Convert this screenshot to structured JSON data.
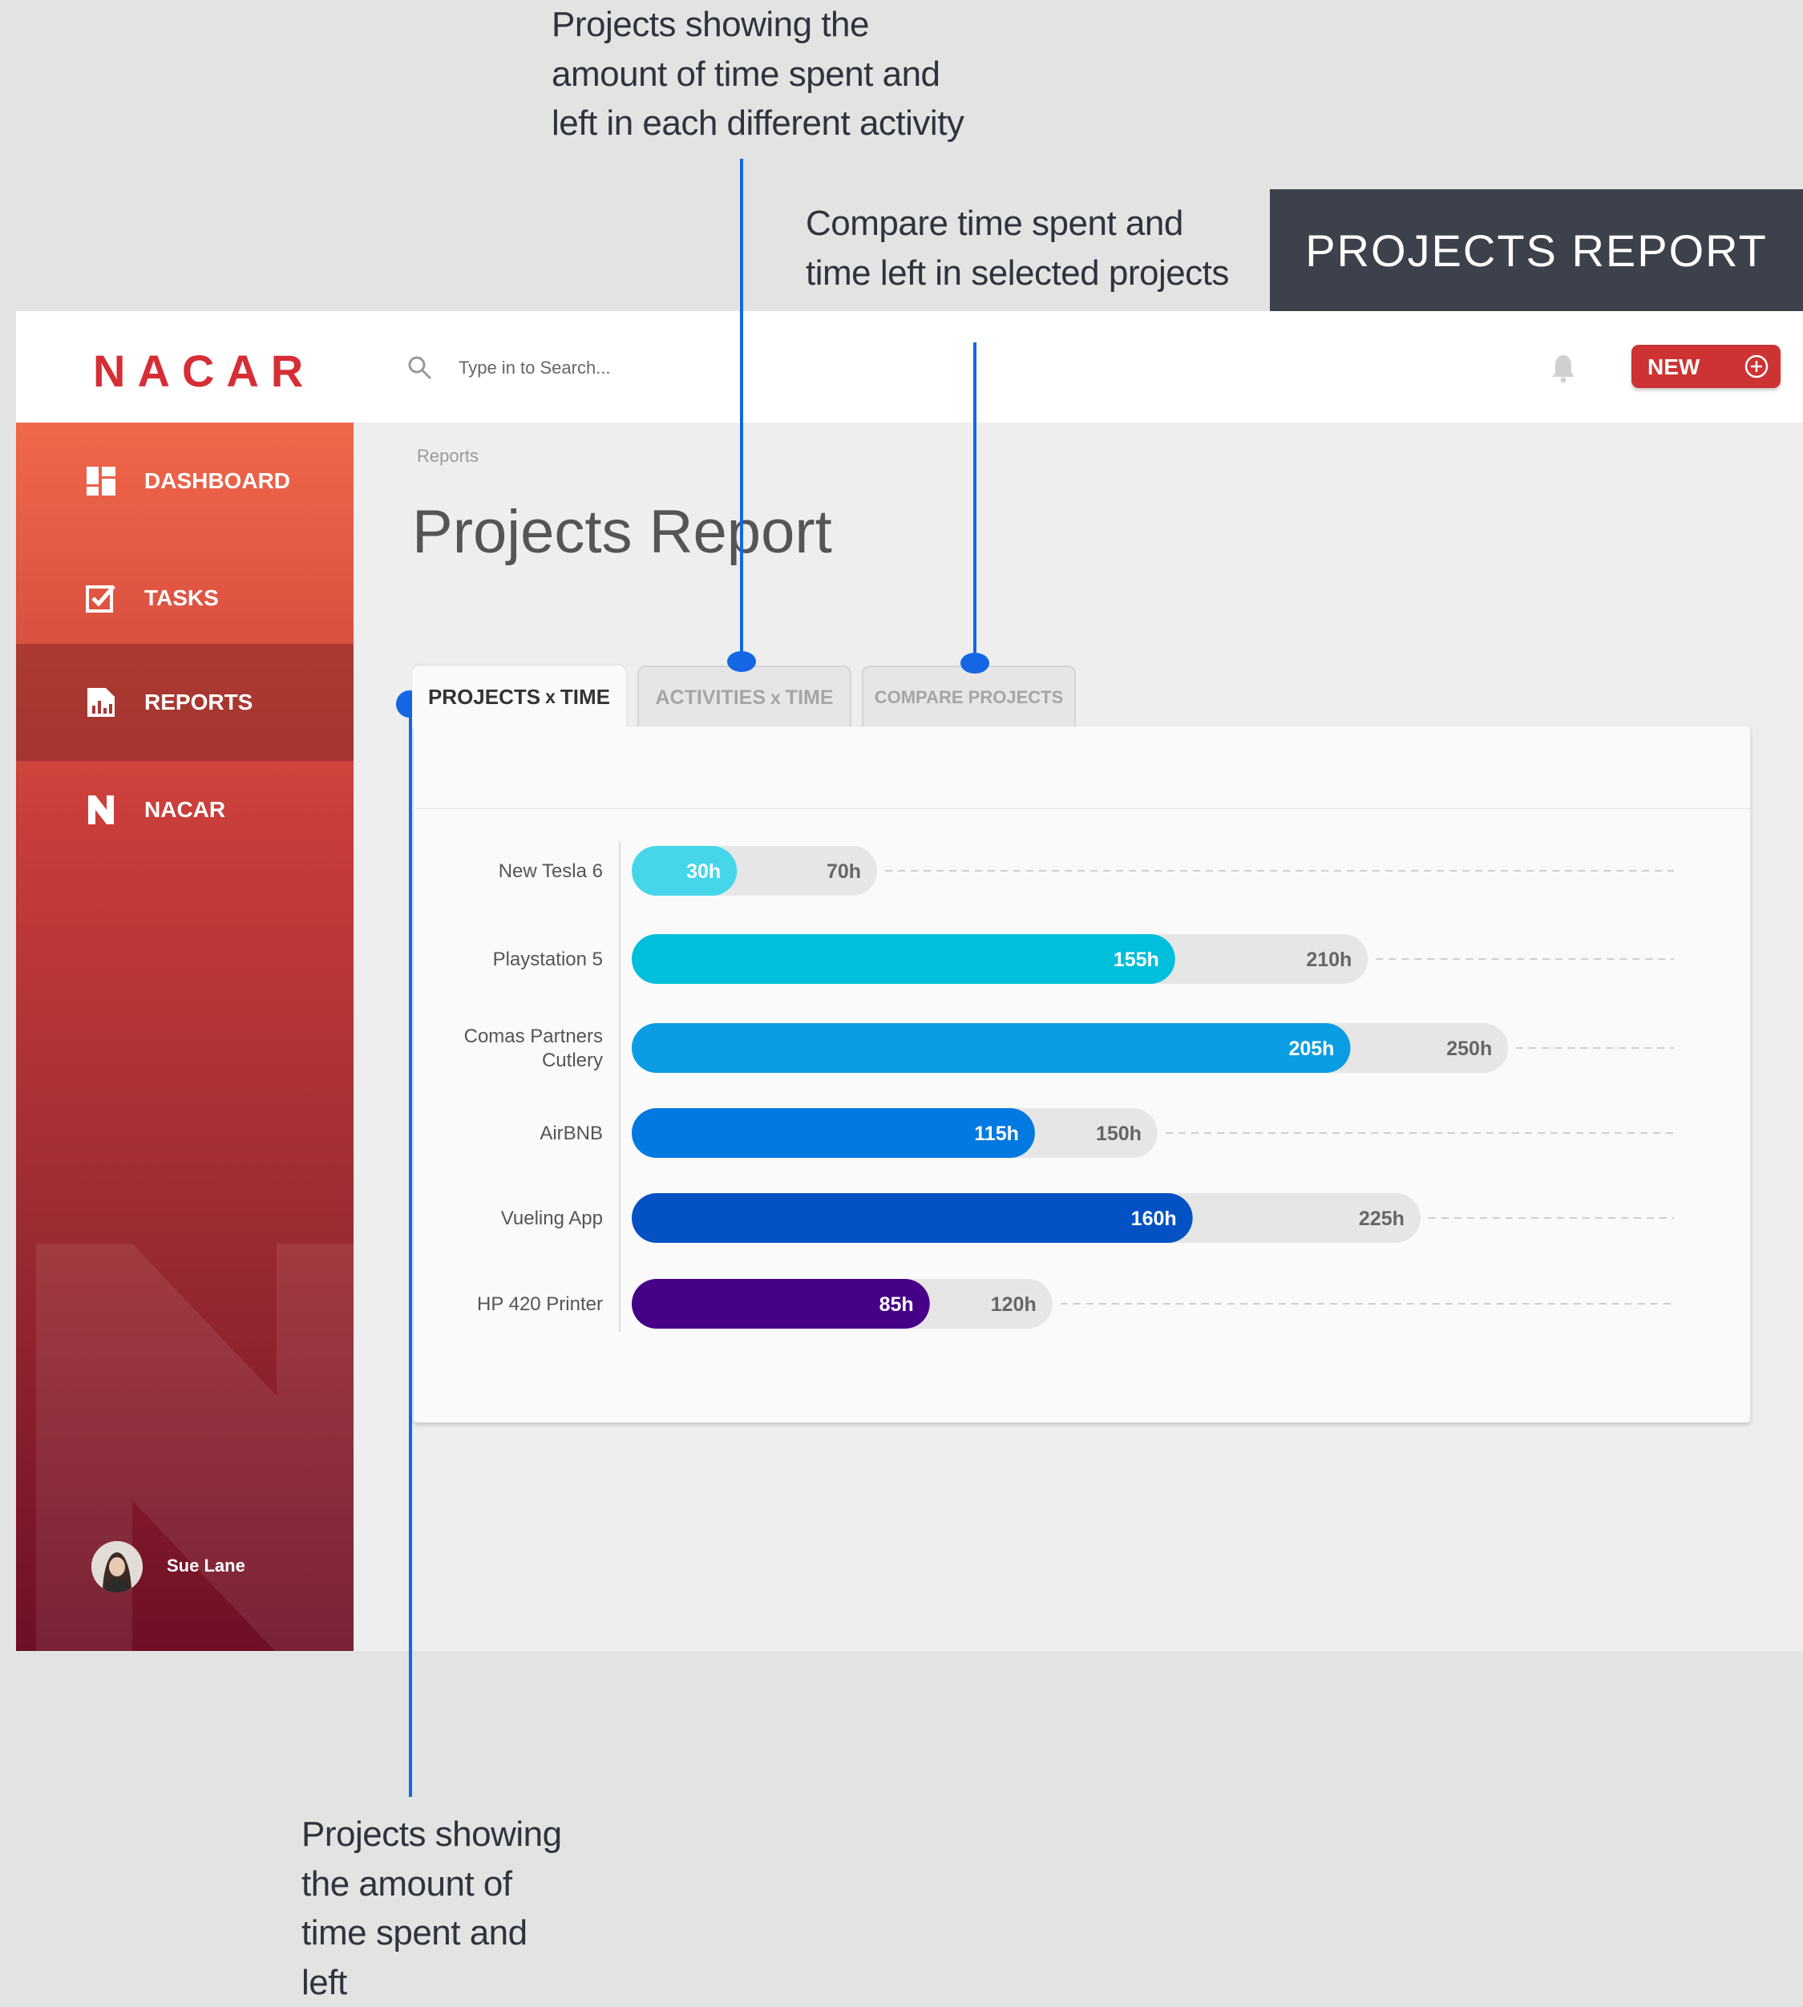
{
  "annotations": {
    "top_lines": [
      "Projects showing the",
      "amount of time spent and",
      "left in each different activity"
    ],
    "middle_lines": [
      "Compare time spent and",
      "time left in selected projects"
    ],
    "bottom_lines": [
      "Projects showing",
      "the amount of",
      "time spent and",
      "left"
    ],
    "banner": "PROJECTS REPORT"
  },
  "header": {
    "logo": "NACAR",
    "search_placeholder": "Type in to Search...",
    "new_button": "NEW"
  },
  "sidebar": {
    "items": [
      {
        "label": "DASHBOARD",
        "icon": "dashboard-icon"
      },
      {
        "label": "TASKS",
        "icon": "tasks-icon"
      },
      {
        "label": "REPORTS",
        "icon": "reports-icon",
        "active": true
      },
      {
        "label": "NACAR",
        "icon": "nacar-logo-icon"
      }
    ],
    "user": {
      "name": "Sue Lane"
    }
  },
  "main": {
    "breadcrumb": "Reports",
    "title": "Projects Report",
    "tabs": [
      {
        "main": "PROJECTS",
        "sep": "x",
        "rest": "TIME",
        "active": true
      },
      {
        "main": "ACTIVITIES",
        "sep": "x",
        "rest": "TIME"
      },
      {
        "main": "COMPARE PROJECTS"
      }
    ]
  },
  "chart_data": {
    "type": "bar",
    "orientation": "horizontal",
    "categories": [
      "New Tesla 6",
      "Playstation 5",
      "Comas Partners Cutlery",
      "AirBNB",
      "Vueling App",
      "HP 420 Printer"
    ],
    "series": [
      {
        "values": [
          30,
          155,
          205,
          115,
          160,
          85
        ],
        "labels": [
          "30h",
          "155h",
          "205h",
          "115h",
          "160h",
          "85h"
        ]
      },
      {
        "values": [
          70,
          210,
          250,
          150,
          225,
          120
        ],
        "labels": [
          "70h",
          "210h",
          "250h",
          "150h",
          "225h",
          "120h"
        ]
      }
    ],
    "colors": [
      "#45d6ea",
      "#00bfdb",
      "#0a9de3",
      "#0179e0",
      "#0451c4",
      "#460088"
    ],
    "total_bar_color": "#e6e6e6",
    "ylim": [
      0,
      295
    ]
  }
}
